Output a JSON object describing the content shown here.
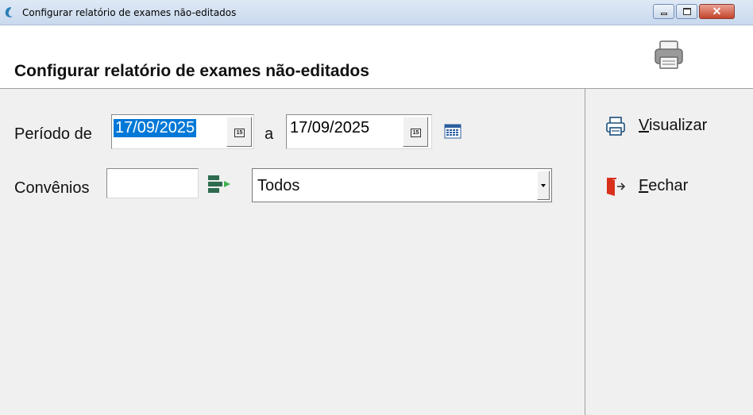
{
  "window": {
    "title": "Configurar relatório de exames não-editados",
    "close_glyph": "✕"
  },
  "header": {
    "title": "Configurar relatório de exames não-editados",
    "print_icon": "printer-icon"
  },
  "form": {
    "periodo_label": "Período de",
    "date_from": "17/09/2025",
    "a_label": "a",
    "date_to": "17/09/2025",
    "calendar_day": "15",
    "convenios_label": "Convênios",
    "convenios_code": "",
    "convenios_select": {
      "selected": "Todos"
    }
  },
  "actions": {
    "visualizar": {
      "mnemonic": "V",
      "rest": "isualizar",
      "icon": "printer-icon"
    },
    "fechar": {
      "mnemonic": "F",
      "rest": "echar",
      "icon": "exit-door-icon"
    }
  },
  "colors": {
    "selection": "#0078d7",
    "close_red": "#d9301c",
    "filter_green": "#2e7d32"
  }
}
